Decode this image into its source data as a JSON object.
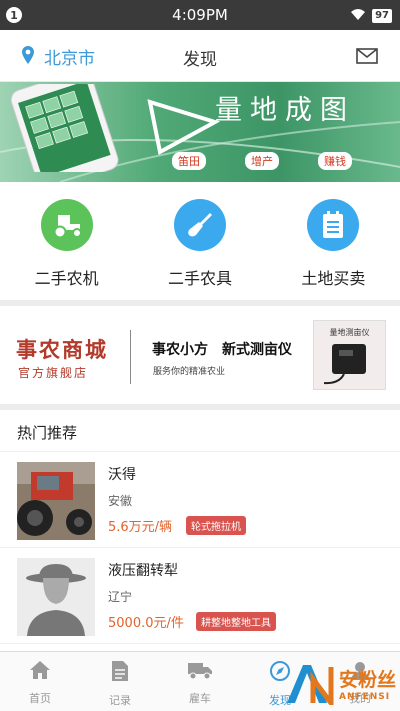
{
  "status_bar": {
    "notification_count": "1",
    "time": "4:09PM",
    "battery": "97"
  },
  "header": {
    "location": "北京市",
    "title": "发现"
  },
  "banner": {
    "title": "量地成图",
    "tags": [
      "笛田",
      "增产",
      "赚钱"
    ]
  },
  "categories": [
    {
      "label": "二手农机",
      "icon": "tractor-icon",
      "color": "#5cc35a"
    },
    {
      "label": "二手农具",
      "icon": "shovel-icon",
      "color": "#3aa9ee"
    },
    {
      "label": "土地买卖",
      "icon": "document-icon",
      "color": "#3aa9ee"
    }
  ],
  "promo": {
    "store_name": "事农商城",
    "store_sub": "官方旗舰店",
    "headline": "事农小方　新式测亩仪",
    "subline": "服务你的精准农业",
    "product_label": "量地测亩仪"
  },
  "hot": {
    "title": "热门推荐",
    "items": [
      {
        "name": "沃得",
        "region": "安徽",
        "price": "5.6万元/辆",
        "badge": "轮式拖拉机"
      },
      {
        "name": "液压翻转犁",
        "region": "辽宁",
        "price": "5000.0元/件",
        "badge": "耕整地整地工具"
      }
    ]
  },
  "tabs": [
    {
      "label": "首页",
      "icon": "home-icon"
    },
    {
      "label": "记录",
      "icon": "record-icon"
    },
    {
      "label": "雇车",
      "icon": "truck-icon"
    },
    {
      "label": "发现",
      "icon": "discover-icon"
    },
    {
      "label": "我的",
      "icon": "user-icon"
    }
  ],
  "watermark": {
    "cn": "安粉丝",
    "en": "ANFENSI"
  }
}
